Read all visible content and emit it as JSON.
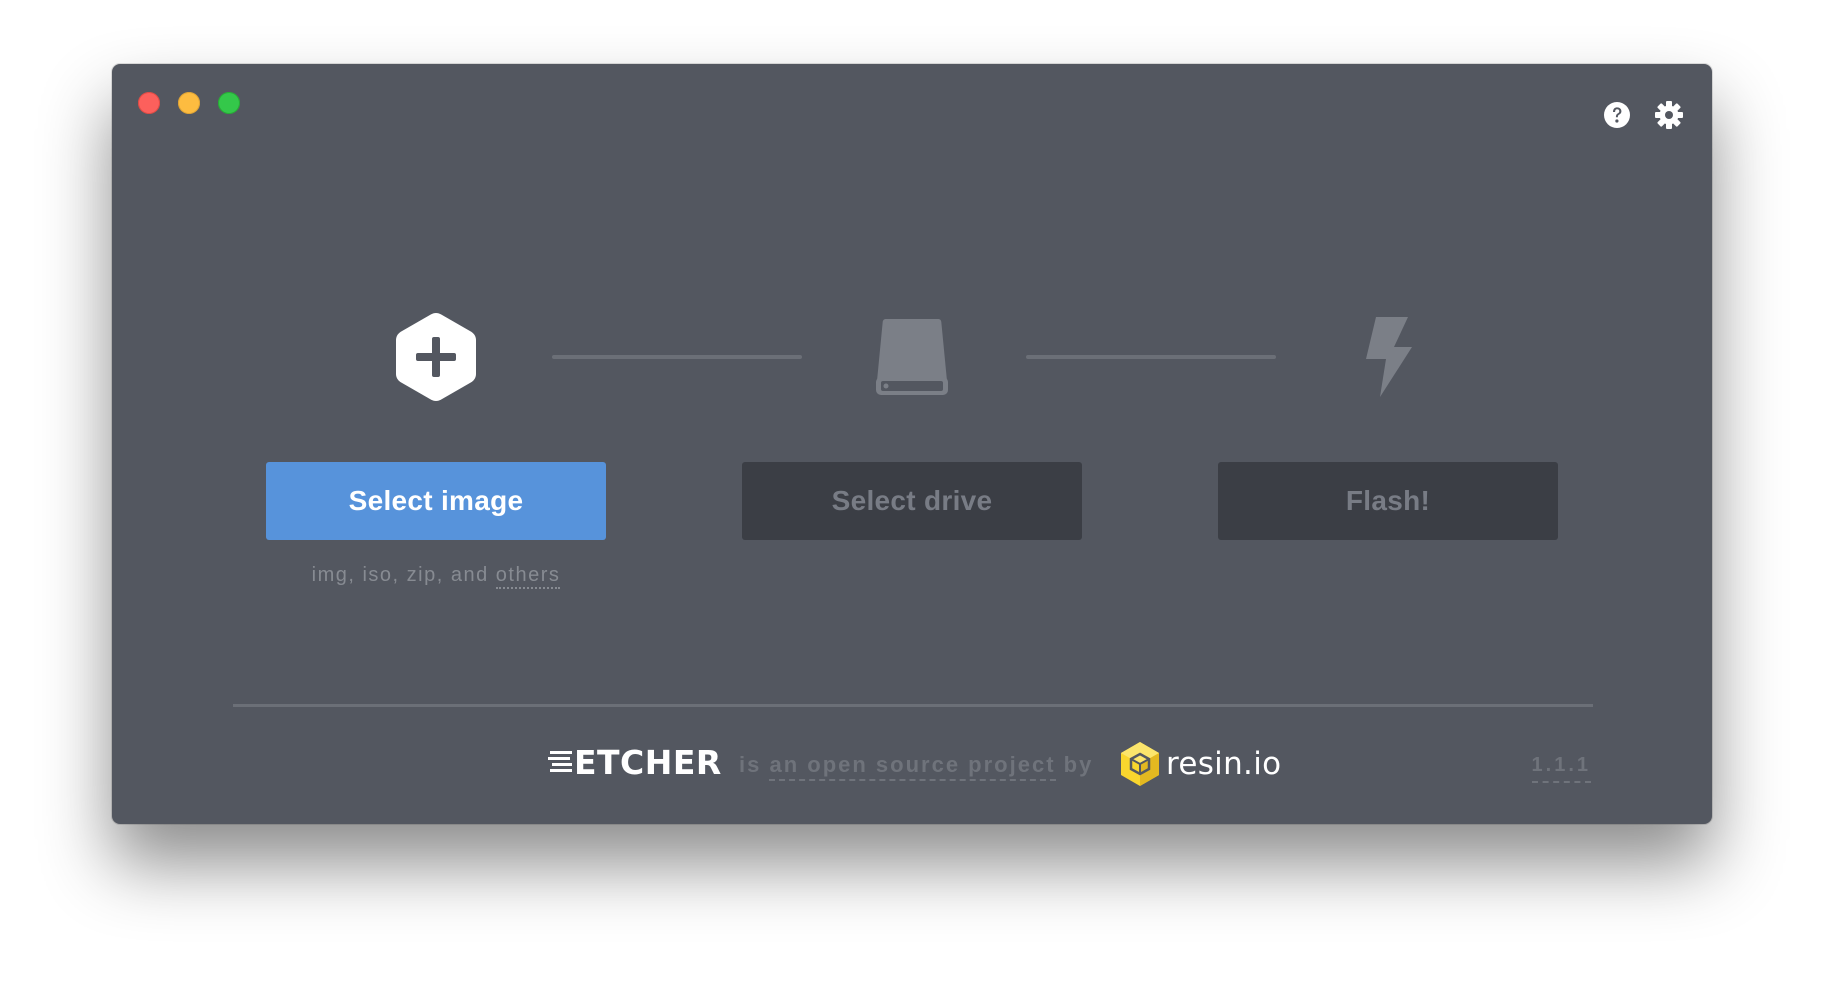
{
  "window": {
    "controls": [
      "close",
      "minimize",
      "zoom"
    ]
  },
  "toolbar": {
    "icons": [
      "help-icon",
      "settings-icon"
    ]
  },
  "steps": {
    "image": {
      "icon": "plus-hexagon-icon",
      "button_label": "Select image",
      "hint_text": "img, iso, zip, and ",
      "hint_link": "others"
    },
    "drive": {
      "icon": "drive-icon",
      "button_label": "Select drive"
    },
    "flash": {
      "icon": "lightning-icon",
      "button_label": "Flash!"
    }
  },
  "footer": {
    "brand": "ETCHER",
    "tagline_prefix": "is ",
    "tagline_link": "an open source project",
    "tagline_suffix": " by",
    "company": "resin.io",
    "version": "1.1.1"
  },
  "colors": {
    "window_bg": "#535760",
    "primary": "#5793db",
    "disabled_button": "#3b3e45",
    "accent_logo": "#f9d62e"
  }
}
